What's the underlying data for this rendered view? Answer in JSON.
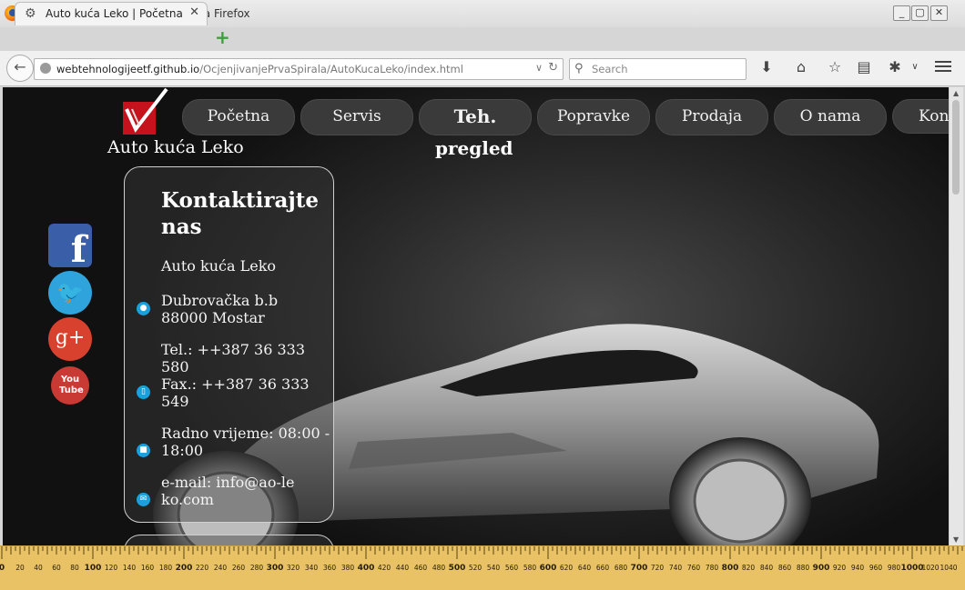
{
  "window": {
    "title": "Auto kuća Leko | Početna - Mozilla Firefox"
  },
  "tabs": [
    {
      "label": "Auto kuća Leko | Početna",
      "icon": "gear-icon"
    }
  ],
  "toolbar": {
    "url_host": "webtehnologijeetf.github.io",
    "url_path": "/OcjenjivanjePrvaSpirala/AutoKucaLeko/index.html",
    "search_placeholder": "Search",
    "icons": [
      "download-icon",
      "home-icon",
      "bookmark-star-icon",
      "reading-list-icon",
      "extension-icon",
      "menu-icon"
    ]
  },
  "site": {
    "name": "Auto kuća Leko",
    "nav": [
      {
        "label": "Početna"
      },
      {
        "label": "Servis"
      },
      {
        "label": "Teh.",
        "label2": "pregled",
        "active": true
      },
      {
        "label": "Popravke"
      },
      {
        "label": "Prodaja"
      },
      {
        "label": "O nama"
      },
      {
        "label": "Kont"
      }
    ],
    "social": [
      {
        "name": "facebook-icon",
        "glyph": "f"
      },
      {
        "name": "twitter-icon",
        "glyph": "🐦"
      },
      {
        "name": "google-plus-icon",
        "glyph": "g+"
      },
      {
        "name": "youtube-icon",
        "glyph": "You Tube"
      }
    ],
    "contact": {
      "title": "Kontaktirajte nas",
      "company": "Auto kuća Leko",
      "address": "Dubrovačka b.b 88000 Mostar",
      "phone": "Tel.: ++387 36 333 580",
      "fax": "Fax.: ++387 36 333 549",
      "hours": "Radno vrijeme: 08:00 - 18:00",
      "email": "e-mail: info@ao-leko.com"
    }
  },
  "ruler": {
    "labels": [
      "0",
      "20",
      "40",
      "60",
      "80",
      "100",
      "120",
      "140",
      "160",
      "180",
      "200",
      "220",
      "240",
      "260",
      "280",
      "300",
      "320",
      "340",
      "360",
      "380",
      "400",
      "420",
      "440",
      "460",
      "480",
      "500",
      "520",
      "540",
      "560",
      "580",
      "600",
      "620",
      "640",
      "660",
      "680",
      "700",
      "720",
      "740",
      "760",
      "780",
      "800",
      "820",
      "840",
      "860",
      "880",
      "900",
      "920",
      "940",
      "960",
      "980",
      "1000",
      "1020",
      "1040"
    ]
  },
  "colors": {
    "accent": "#1aa0dc",
    "logo": "#c5121c",
    "ruler": "#e9c266"
  }
}
